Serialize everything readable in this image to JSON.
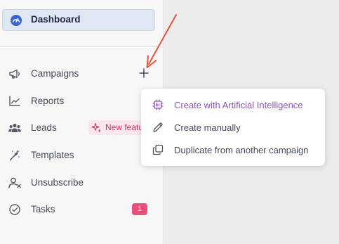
{
  "colors": {
    "sidebar_bg": "#f7f7f8",
    "active_bg": "#dfe7f3",
    "accent_pink": "#e8527a",
    "ai_purple": "#9150b6",
    "arrow": "#e8543a"
  },
  "sidebar": {
    "dashboard": {
      "label": "Dashboard",
      "icon": "dashboard-gauge-icon"
    },
    "items": [
      {
        "label": "Campaigns",
        "icon": "megaphone-icon"
      },
      {
        "label": "Reports",
        "icon": "chart-line-icon"
      },
      {
        "label": "Leads",
        "icon": "users-icon",
        "badge": "New featu"
      },
      {
        "label": "Templates",
        "icon": "magic-wand-icon"
      },
      {
        "label": "Unsubscribe",
        "icon": "user-x-icon"
      },
      {
        "label": "Tasks",
        "icon": "check-circle-icon",
        "count": "1"
      }
    ]
  },
  "campaign_menu": {
    "items": [
      {
        "label": "Create with Artificial Intelligence",
        "icon": "ai-chip-icon"
      },
      {
        "label": "Create manually",
        "icon": "pencil-icon"
      },
      {
        "label": "Duplicate from another campaign",
        "icon": "copy-icon"
      }
    ]
  }
}
